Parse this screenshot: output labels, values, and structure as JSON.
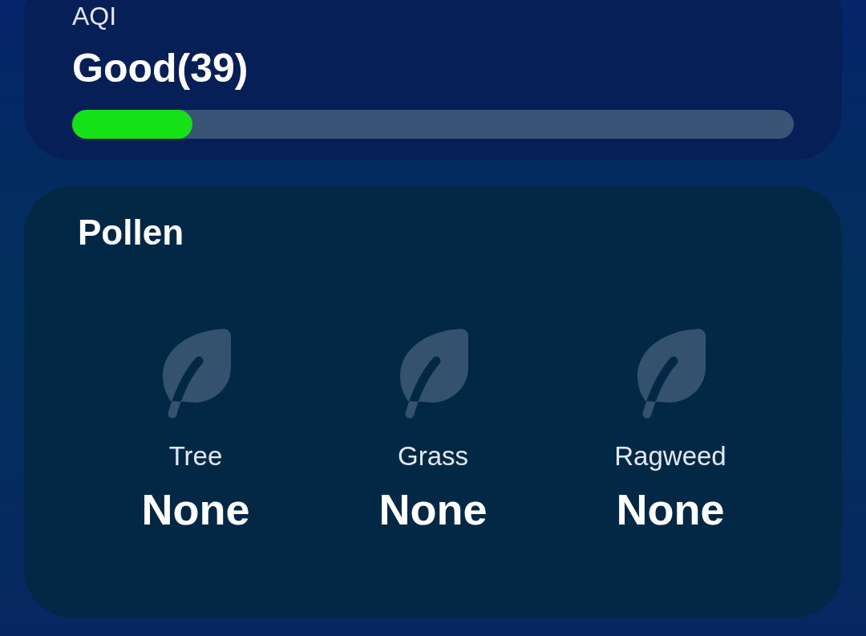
{
  "aqi": {
    "label": "AQI",
    "value": "Good(39)",
    "level": 0.167
  },
  "pollen": {
    "title": "Pollen",
    "items": [
      {
        "label": "Tree",
        "value": "None"
      },
      {
        "label": "Grass",
        "value": "None"
      },
      {
        "label": "Ragweed",
        "value": "None"
      }
    ]
  }
}
